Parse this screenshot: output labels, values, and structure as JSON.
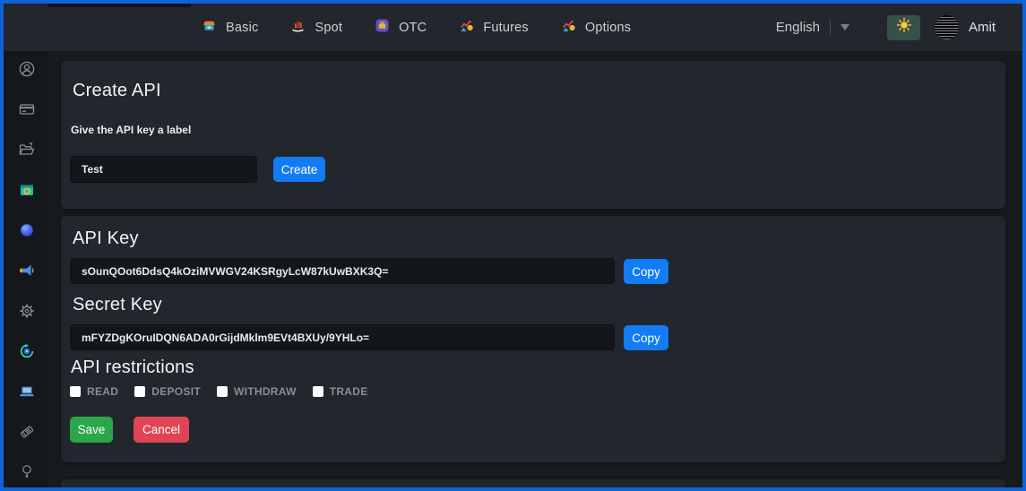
{
  "header": {
    "nav": [
      {
        "label": "Basic",
        "icon": "basic-icon"
      },
      {
        "label": "Spot",
        "icon": "spot-icon"
      },
      {
        "label": "OTC",
        "icon": "otc-icon"
      },
      {
        "label": "Futures",
        "icon": "futures-icon"
      },
      {
        "label": "Options",
        "icon": "options-icon"
      }
    ],
    "language": {
      "label": "English",
      "dropdown_icon": "chevron-down-icon"
    },
    "theme_toggle": {
      "icon": "sun-icon"
    },
    "user": {
      "name": "Amit",
      "icon": "avatar"
    }
  },
  "sidebar": {
    "items": [
      {
        "icon": "profile-icon"
      },
      {
        "icon": "card-icon"
      },
      {
        "icon": "folder-export-icon"
      },
      {
        "icon": "wallet-icon"
      },
      {
        "icon": "globe-icon"
      },
      {
        "icon": "announcement-icon"
      },
      {
        "icon": "settings-icon"
      },
      {
        "icon": "convert-icon"
      },
      {
        "icon": "device-icon"
      },
      {
        "icon": "tag-icon"
      },
      {
        "icon": "bulb-icon"
      }
    ]
  },
  "create_api": {
    "title": "Create API",
    "label_caption": "Give the API key a label",
    "label_value": "Test",
    "create_button": "Create"
  },
  "api_key": {
    "title": "API Key",
    "value": "sOunQOot6DdsQ4kOziMVWGV24KSRgyLcW87kUwBXK3Q=",
    "copy_button": "Copy"
  },
  "secret_key": {
    "title": "Secret Key",
    "value": "mFYZDgKOruIDQN6ADA0rGijdMklm9EVt4BXUy/9YHLo=",
    "copy_button": "Copy"
  },
  "restrictions": {
    "title": "API restrictions",
    "options": [
      {
        "label": "READ",
        "checked": false
      },
      {
        "label": "DEPOSIT",
        "checked": false
      },
      {
        "label": "WITHDRAW",
        "checked": false
      },
      {
        "label": "TRADE",
        "checked": false
      }
    ],
    "save_button": "Save",
    "cancel_button": "Cancel"
  },
  "colors": {
    "accent_blue": "#117cf4",
    "save_green": "#2aa64b",
    "cancel_red": "#e04553",
    "window_border_blue": "#0f63d6",
    "theme_toggle_bg": "#35524a",
    "header_bg": "#23272d",
    "card_bg": "#22262d"
  }
}
